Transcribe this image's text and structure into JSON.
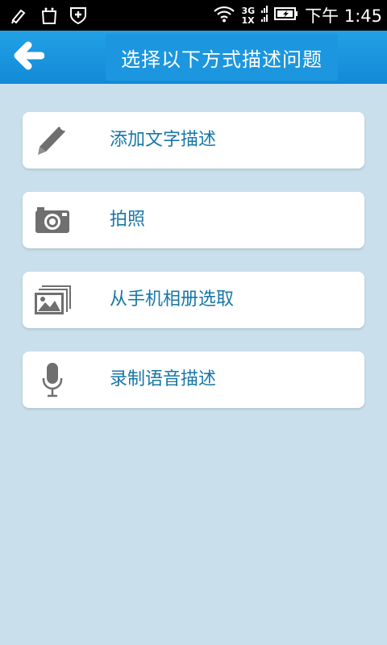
{
  "status_bar": {
    "network_top": "3G",
    "network_bottom": "1X",
    "time": "下午 1:45",
    "icons": [
      "brush-notification-icon",
      "shopping-bag-icon",
      "shield-plus-icon",
      "wifi-icon",
      "signal-icon",
      "battery-charging-icon"
    ]
  },
  "header": {
    "title": "选择以下方式描述问题",
    "back_icon": "arrow-left-icon"
  },
  "options": [
    {
      "label": "添加文字描述",
      "icon": "pencil-icon"
    },
    {
      "label": "拍照",
      "icon": "camera-icon"
    },
    {
      "label": "从手机相册选取",
      "icon": "gallery-icon"
    },
    {
      "label": "录制语音描述",
      "icon": "microphone-icon"
    }
  ],
  "colors": {
    "background": "#c9e0ec",
    "title_bar": "#1a92dc",
    "label_text": "#1777a8",
    "icon_gray": "#6f6f6f"
  }
}
